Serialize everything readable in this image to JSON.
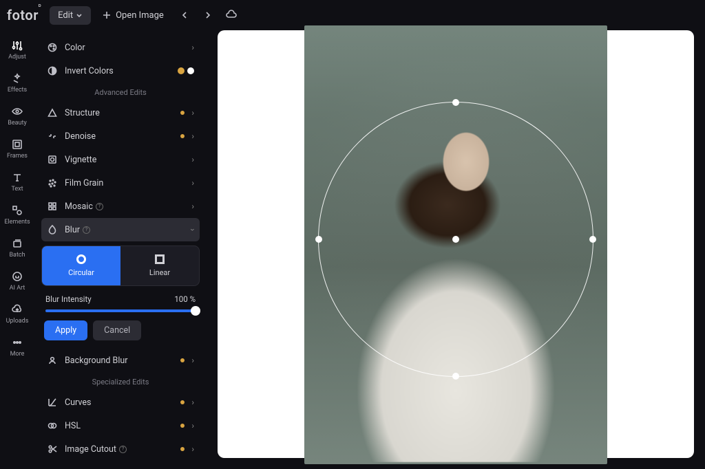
{
  "topbar": {
    "logo": "fotor",
    "edit": "Edit",
    "openImage": "Open Image"
  },
  "rail": [
    {
      "id": "adjust",
      "label": "Adjust"
    },
    {
      "id": "effects",
      "label": "Effects"
    },
    {
      "id": "beauty",
      "label": "Beauty"
    },
    {
      "id": "frames",
      "label": "Frames"
    },
    {
      "id": "text",
      "label": "Text"
    },
    {
      "id": "elements",
      "label": "Elements"
    },
    {
      "id": "batch",
      "label": "Batch"
    },
    {
      "id": "aiart",
      "label": "AI Art"
    },
    {
      "id": "uploads",
      "label": "Uploads"
    },
    {
      "id": "more",
      "label": "More"
    }
  ],
  "panel": {
    "color": "Color",
    "invertColors": "Invert Colors",
    "advancedHeader": "Advanced Edits",
    "structure": "Structure",
    "denoise": "Denoise",
    "vignette": "Vignette",
    "filmGrain": "Film Grain",
    "mosaic": "Mosaic",
    "blur": "Blur",
    "circular": "Circular",
    "linear": "Linear",
    "intensityLabel": "Blur Intensity",
    "intensityValue": "100 %",
    "apply": "Apply",
    "cancel": "Cancel",
    "backgroundBlur": "Background Blur",
    "specializedHeader": "Specialized Edits",
    "curves": "Curves",
    "hsl": "HSL",
    "imageCutout": "Image Cutout"
  }
}
